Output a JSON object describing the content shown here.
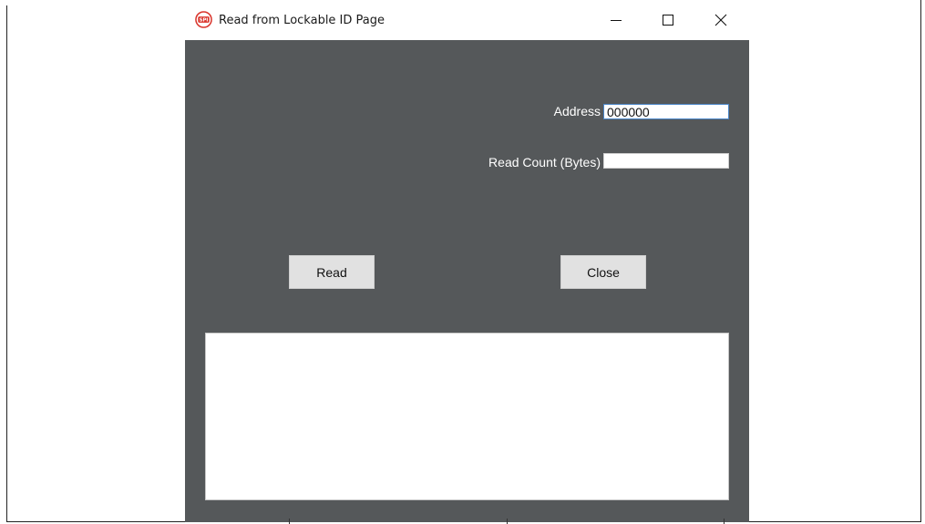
{
  "window": {
    "title": "Read from Lockable ID Page",
    "icon": "spi-app-icon",
    "controls": [
      "minimize-icon",
      "maximize-icon",
      "close-icon"
    ]
  },
  "form": {
    "address_label": "Address",
    "address_value": "000000",
    "read_count_label": "Read Count (Bytes)",
    "read_count_value": ""
  },
  "buttons": {
    "read": "Read",
    "close": "Close"
  },
  "output": {
    "text": ""
  },
  "colors": {
    "background": "#55585a",
    "accent_icon": "#d9342b"
  }
}
